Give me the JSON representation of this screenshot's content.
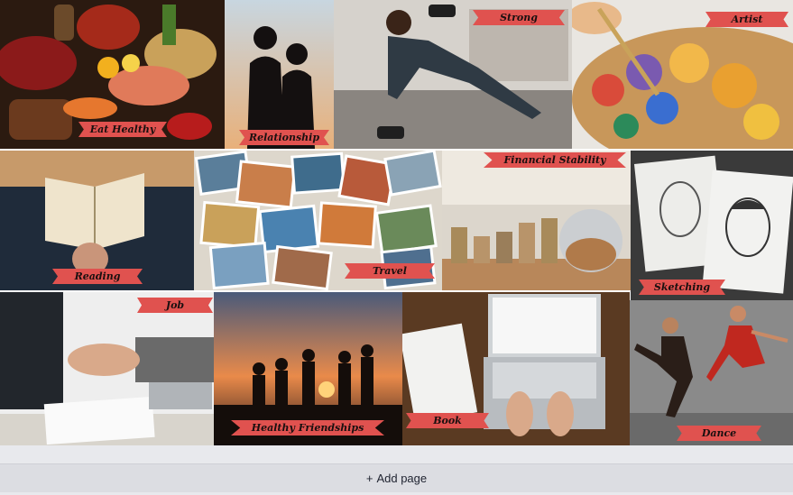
{
  "tiles": [
    {
      "id": "eat-healthy",
      "label": "Eat Healthy"
    },
    {
      "id": "relationship",
      "label": "Relationship"
    },
    {
      "id": "strong",
      "label": "Strong"
    },
    {
      "id": "artist",
      "label": "Artist"
    },
    {
      "id": "reading",
      "label": "Reading"
    },
    {
      "id": "travel",
      "label": "Travel"
    },
    {
      "id": "financial-stability",
      "label": "Financial Stability"
    },
    {
      "id": "sketching",
      "label": "Sketching"
    },
    {
      "id": "job",
      "label": "Job"
    },
    {
      "id": "healthy-friendships",
      "label": "Healthy Friendships"
    },
    {
      "id": "book",
      "label": "Book"
    },
    {
      "id": "dance",
      "label": "Dance"
    }
  ],
  "footer": {
    "add_page_icon": "+",
    "add_page_label": "Add page"
  },
  "colors": {
    "ribbon": "#e0524f",
    "background": "#e8e9ed"
  }
}
